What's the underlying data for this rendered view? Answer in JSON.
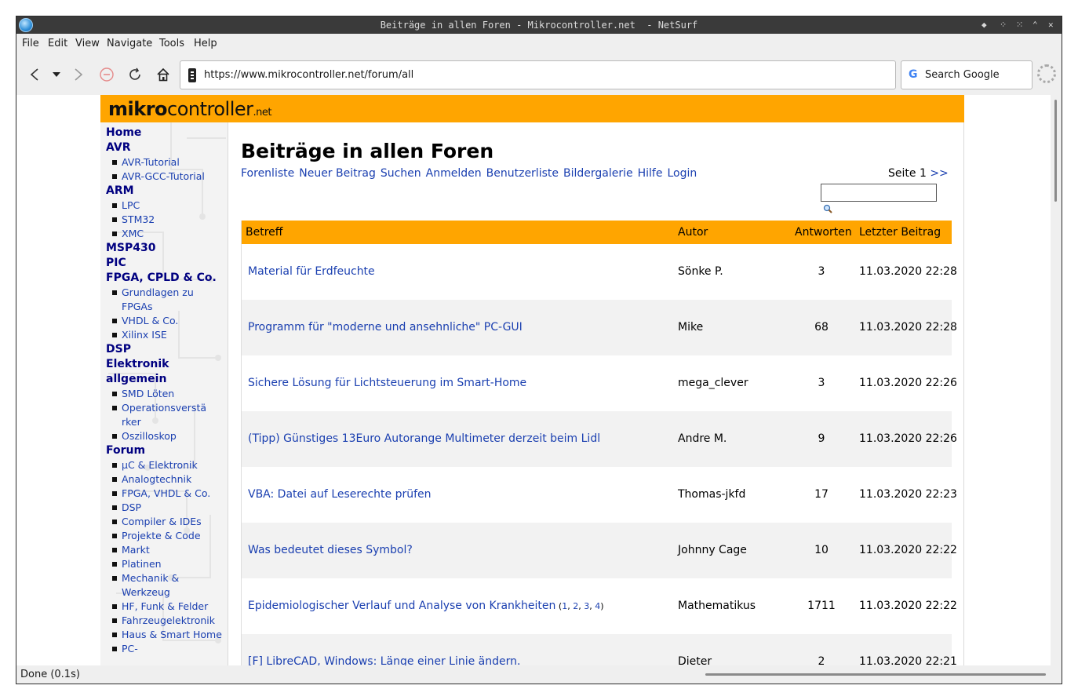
{
  "window": {
    "title": "Beiträge in allen Foren - Mikrocontroller.net  - NetSurf"
  },
  "menu": [
    "File",
    "Edit",
    "View",
    "Navigate",
    "Tools",
    "Help"
  ],
  "toolbar": {
    "url": "https://www.mikrocontroller.net/forum/all",
    "search_placeholder": "Search Google"
  },
  "status": {
    "text": "Done (0.1s)"
  },
  "site": {
    "logo_bold": "mikro",
    "logo_rest": "controller",
    "logo_tld": ".net",
    "accent_color": "#ffa500"
  },
  "sidebar": [
    {
      "type": "h",
      "label": "Home"
    },
    {
      "type": "h",
      "label": "AVR"
    },
    {
      "type": "s",
      "label": "AVR-Tutorial"
    },
    {
      "type": "s",
      "label": "AVR-GCC-Tutorial"
    },
    {
      "type": "h",
      "label": "ARM"
    },
    {
      "type": "s",
      "label": "LPC"
    },
    {
      "type": "s",
      "label": "STM32"
    },
    {
      "type": "s",
      "label": "XMC"
    },
    {
      "type": "h",
      "label": "MSP430"
    },
    {
      "type": "h",
      "label": "PIC"
    },
    {
      "type": "h",
      "label": "FPGA, CPLD & Co."
    },
    {
      "type": "s",
      "label": "Grundlagen zu FPGAs"
    },
    {
      "type": "s",
      "label": "VHDL & Co."
    },
    {
      "type": "s",
      "label": "Xilinx ISE"
    },
    {
      "type": "h",
      "label": "DSP"
    },
    {
      "type": "h",
      "label": "Elektronik allgemein"
    },
    {
      "type": "s",
      "label": "SMD Löten"
    },
    {
      "type": "s",
      "label": "Operationsverstä rker"
    },
    {
      "type": "s",
      "label": "Oszilloskop"
    },
    {
      "type": "h",
      "label": "Forum"
    },
    {
      "type": "s",
      "label": "µC & Elektronik"
    },
    {
      "type": "s",
      "label": "Analogtechnik"
    },
    {
      "type": "s",
      "label": "FPGA, VHDL & Co."
    },
    {
      "type": "s",
      "label": "DSP"
    },
    {
      "type": "s",
      "label": "Compiler & IDEs"
    },
    {
      "type": "s",
      "label": "Projekte & Code"
    },
    {
      "type": "s",
      "label": "Markt"
    },
    {
      "type": "s",
      "label": "Platinen"
    },
    {
      "type": "s",
      "label": "Mechanik & Werkzeug"
    },
    {
      "type": "s",
      "label": "HF, Funk & Felder"
    },
    {
      "type": "s",
      "label": "Fahrzeugelektronik"
    },
    {
      "type": "s",
      "label": "Haus & Smart Home"
    },
    {
      "type": "s",
      "label": "PC-"
    }
  ],
  "main": {
    "title": "Beiträge in allen Foren",
    "links": [
      "Forenliste",
      "Neuer Beitrag",
      "Suchen",
      "Anmelden",
      "Benutzerliste",
      "Bildergalerie",
      "Hilfe",
      "Login"
    ],
    "page_label": "Seite 1",
    "next_label": ">>",
    "columns": [
      "Betreff",
      "Autor",
      "Antworten",
      "Letzter Beitrag"
    ],
    "rows": [
      {
        "subject": "Material für Erdfeuchte",
        "author": "Sönke P.",
        "replies": "3",
        "date": "11.03.2020 22:28"
      },
      {
        "subject": "Programm für \"moderne und ansehnliche\" PC-GUI",
        "author": "Mike",
        "replies": "68",
        "date": "11.03.2020 22:28"
      },
      {
        "subject": "Sichere Lösung für Lichtsteuerung im Smart-Home",
        "author": "mega_clever",
        "replies": "3",
        "date": "11.03.2020 22:26"
      },
      {
        "subject": "(Tipp) Günstiges 13Euro Autorange Multimeter derzeit beim Lidl",
        "author": "Andre M.",
        "replies": "9",
        "date": "11.03.2020 22:26"
      },
      {
        "subject": "VBA: Datei auf Leserechte prüfen",
        "author": "Thomas-jkfd",
        "replies": "17",
        "date": "11.03.2020 22:23"
      },
      {
        "subject": "Was bedeutet dieses Symbol?",
        "author": "Johnny Cage",
        "replies": "10",
        "date": "11.03.2020 22:22"
      },
      {
        "subject": "Epidemiologischer Verlauf und Analyse von Krankheiten",
        "pages": [
          "1",
          "2",
          "3",
          "4"
        ],
        "author": "Mathematikus",
        "replies": "1711",
        "date": "11.03.2020 22:22"
      },
      {
        "subject": "[F] LibreCAD, Windows: Länge einer Linie ändern.",
        "author": "Dieter",
        "replies": "2",
        "date": "11.03.2020 22:21"
      }
    ]
  }
}
